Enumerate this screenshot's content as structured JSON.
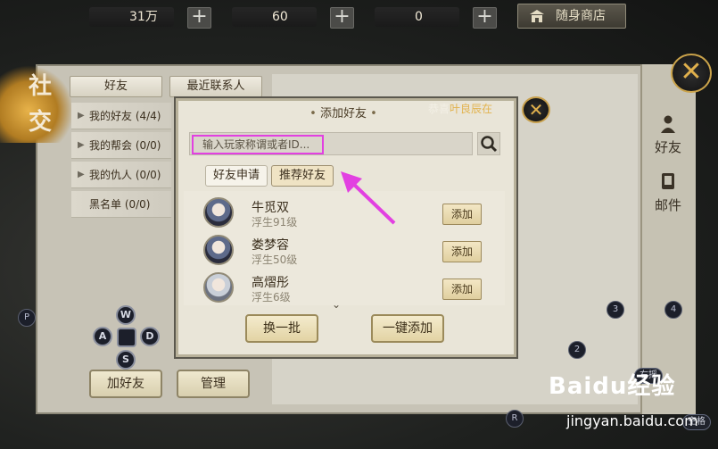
{
  "currencies": [
    {
      "name": "silver",
      "value": "31万",
      "icon": "silver-ingot-icon"
    },
    {
      "name": "gold",
      "value": "60",
      "icon": "gold-ingot-icon"
    },
    {
      "name": "bound-gold",
      "value": "0",
      "icon": "bound-gold-ingot-icon"
    }
  ],
  "plus_label": "+",
  "shop": {
    "label": "随身商店",
    "icon": "shop-icon"
  },
  "social": {
    "title_chars": [
      "社",
      "交"
    ],
    "tabs": [
      "好友",
      "最近联系人"
    ],
    "categories": [
      {
        "label": "我的好友 (4/4)"
      },
      {
        "label": "我的帮会 (0/0)"
      },
      {
        "label": "我的仇人 (0/0)"
      },
      {
        "label": "黑名单 (0/0)"
      }
    ],
    "bottom_buttons": {
      "add_friend": "加好友",
      "manage": "管理"
    },
    "side_tabs": [
      {
        "label": "好友",
        "icon": "person-icon"
      },
      {
        "label": "邮件",
        "icon": "mail-icon"
      }
    ],
    "close_label": "✕"
  },
  "dialog": {
    "title": "添加好友",
    "notice_prefix": "恭喜",
    "notice_highlight": "叶良辰在",
    "close_label": "✕",
    "search": {
      "placeholder": "输入玩家称谓或者ID..."
    },
    "subtabs": [
      "好友申请",
      "推荐好友"
    ],
    "friends": [
      {
        "name": "牛觅双",
        "level": "浮生91级"
      },
      {
        "name": "娄梦容",
        "level": "浮生50级"
      },
      {
        "name": "高熠彤",
        "level": "浮生6级"
      }
    ],
    "add_label": "添加",
    "more_label": "⌄",
    "buttons": {
      "refresh": "换一批",
      "add_all": "一键添加"
    }
  },
  "hud": {
    "markers": [
      "P",
      "3",
      "4",
      "2",
      "R"
    ],
    "dpad": {
      "up": "W",
      "left": "A",
      "right": "D",
      "down": "S"
    },
    "keys": {
      "right_stick": "右摇",
      "space": "空格"
    }
  },
  "watermark": {
    "logo": "Baidu经验",
    "url": "jingyan.baidu.com"
  },
  "colors": {
    "highlight_box": "#e240e1",
    "arrow": "#e240e1",
    "gold": "#e0b04c"
  }
}
